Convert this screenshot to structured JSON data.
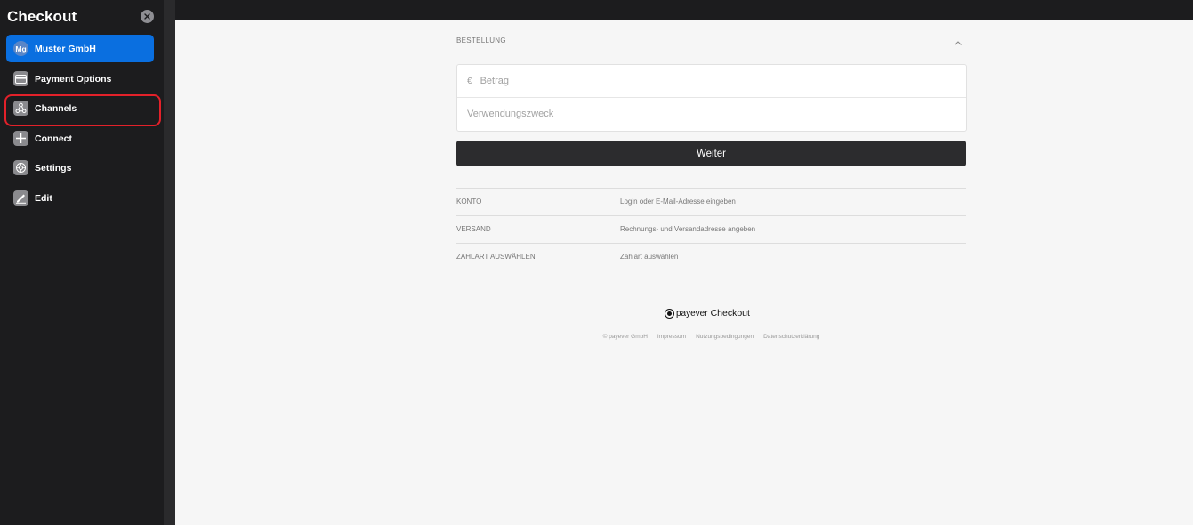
{
  "sidebar": {
    "title": "Checkout",
    "items": [
      {
        "label": "Muster GmbH",
        "icon": "avatar",
        "avatar_text": "Mg",
        "active": true
      },
      {
        "label": "Payment Options",
        "icon": "card-icon"
      },
      {
        "label": "Channels",
        "icon": "channels-icon",
        "highlighted": true
      },
      {
        "label": "Connect",
        "icon": "plus-icon"
      },
      {
        "label": "Settings",
        "icon": "gear-icon"
      },
      {
        "label": "Edit",
        "icon": "edit-icon"
      }
    ]
  },
  "checkout": {
    "section_title": "BESTELLUNG",
    "amount": {
      "currency": "€",
      "placeholder": "Betrag"
    },
    "purpose": {
      "placeholder": "Verwendungszweck"
    },
    "submit_label": "Weiter",
    "steps": [
      {
        "name": "KONTO",
        "description": "Login oder E-Mail-Adresse eingeben"
      },
      {
        "name": "VERSAND",
        "description": "Rechnungs- und Versandadresse angeben"
      },
      {
        "name": "ZAHLART AUSWÄHLEN",
        "description": "Zahlart auswählen"
      }
    ],
    "brand": {
      "name": "payever",
      "product": "Checkout"
    },
    "footer_links": [
      "© payever GmbH",
      "Impressum",
      "Nutzungsbedingungen",
      "Datenschutzerklärung"
    ]
  },
  "colors": {
    "accent": "#0a6fe0",
    "highlight": "#e3212a",
    "sidebar_bg": "#1c1c1e",
    "content_bg": "#f6f6f6",
    "button_bg": "#2c2c2e"
  }
}
